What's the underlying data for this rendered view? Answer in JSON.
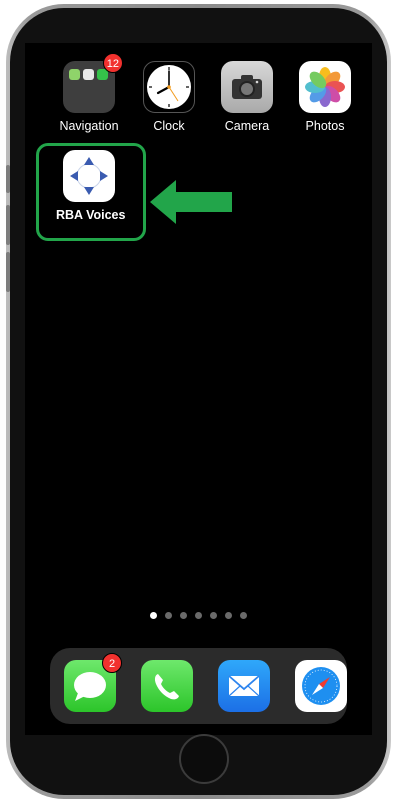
{
  "apps": [
    {
      "label": "Navigation",
      "badge": "12"
    },
    {
      "label": "Clock"
    },
    {
      "label": "Camera"
    },
    {
      "label": "Photos"
    },
    {
      "label": "RBA Voices"
    }
  ],
  "page_dots": {
    "count": 7,
    "active_index": 0
  },
  "dock": [
    {
      "name": "messages",
      "badge": "2"
    },
    {
      "name": "phone"
    },
    {
      "name": "mail"
    },
    {
      "name": "safari"
    }
  ],
  "colors": {
    "highlight": "#22a54a",
    "badge": "#f2312e",
    "screen": "#000000"
  }
}
